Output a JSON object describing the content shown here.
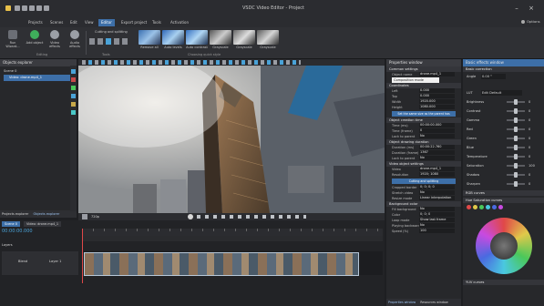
{
  "app": {
    "title": "VSDC Video Editor - Project"
  },
  "menu": {
    "items": [
      "Projects",
      "Scenes",
      "Edit",
      "View",
      "Editor",
      "Export project",
      "Tools",
      "Activation"
    ],
    "active": 4,
    "options_label": "Options"
  },
  "ribbon": {
    "run_wizard": "Run Wizard...",
    "add_object": "Add object",
    "video_effects": "Video effects",
    "audio_effects": "Audio effects",
    "editing_group": "Editing",
    "tools_group": "Tools",
    "cutting_label": "Cutting and splitting",
    "quick_style_group": "Choosing quick style",
    "quick_styles": [
      "Remove all",
      "Auto levels",
      "Auto contrast",
      "Grayscale",
      "Grayscale",
      "Grayscale"
    ]
  },
  "objects_explorer": {
    "title": "Objects explorer",
    "items": [
      "Scene 0",
      "Video: drone.mp4_1"
    ],
    "tabs": [
      "Projects explorer",
      "Objects explorer"
    ]
  },
  "timeline": {
    "timecode": "00:00:00.000",
    "scene_tab": "Scene 0",
    "clip_tab": "Video: drone.mp4_1",
    "layers_label": "Layers",
    "blend_label": "Blend",
    "layer_label": "Layer 1",
    "zoom": "720p"
  },
  "properties": {
    "title": "Properties window",
    "common_settings": "Common settings",
    "object_name_label": "Object name",
    "object_name_value": "drone.mp4_1",
    "composition_mode_tooltip": "Composition mode",
    "coordinates": "Coordinates",
    "coords": [
      {
        "k": "Left",
        "v": "0.000"
      },
      {
        "k": "Top",
        "v": "0.000"
      },
      {
        "k": "Width",
        "v": "1920.000"
      },
      {
        "k": "Height",
        "v": "1080.000"
      }
    ],
    "same_size_btn": "Set the same size as the parent has",
    "creation_time": "Object creation time",
    "creation": [
      {
        "k": "Time (ms)",
        "v": "00:00:00.000"
      },
      {
        "k": "Time (frame)",
        "v": "0"
      },
      {
        "k": "Lock to parent",
        "v": "No"
      }
    ],
    "drawing_duration": "Object drawing duration",
    "duration": [
      {
        "k": "Duration (ms)",
        "v": "00:00:22.760"
      },
      {
        "k": "Duration (frame)",
        "v": "1367"
      },
      {
        "k": "Lock to parent",
        "v": "No"
      }
    ],
    "video_settings": "Video object settings",
    "video": [
      {
        "k": "Video",
        "v": "drone.mp4_1"
      },
      {
        "k": "Resolution",
        "v": "1920; 1080"
      }
    ],
    "cutting_btn": "Cutting and splitting",
    "video2": [
      {
        "k": "Cropped border",
        "v": "0; 0; 0; 0"
      },
      {
        "k": "Stretch video",
        "v": "No"
      },
      {
        "k": "Resize mode",
        "v": "Linear interpolation"
      }
    ],
    "background_color": "Background color",
    "bg": [
      {
        "k": "Fill background",
        "v": "No"
      },
      {
        "k": "Color",
        "v": "0; 0; 0"
      },
      {
        "k": "Loop mode",
        "v": "Show last frame"
      },
      {
        "k": "Playing backward",
        "v": "No"
      },
      {
        "k": "Speed (%)",
        "v": "100"
      }
    ],
    "bottom_tabs": [
      "Properties window",
      "Resources window"
    ]
  },
  "effects": {
    "title": "Basic effects window",
    "basic_correction": "Basic correction",
    "angle_label": "Angle",
    "angle_value": "0.00 °",
    "lut_label": "LUT",
    "lut_value": "Edit Default",
    "rows": [
      {
        "k": "Brightness",
        "v": "0",
        "level": 0.5
      },
      {
        "k": "Contrast",
        "v": "0",
        "level": 0.5
      },
      {
        "k": "Gamma",
        "v": "0",
        "level": 0.5
      },
      {
        "k": "Red",
        "v": "0",
        "level": 0.5
      },
      {
        "k": "Green",
        "v": "0",
        "level": 0.5
      },
      {
        "k": "Blue",
        "v": "0",
        "level": 0.5
      },
      {
        "k": "Temperature",
        "v": "0",
        "level": 0.5
      },
      {
        "k": "Saturation",
        "v": "100",
        "level": 0.5
      },
      {
        "k": "Shadow",
        "v": "0",
        "level": 0.5
      },
      {
        "k": "Sharpen",
        "v": "0",
        "level": 0.5
      }
    ],
    "rgb_curves": "RGB curves",
    "hue_sat": "Hue Saturation curves",
    "yuv": "YUV curves",
    "swatch_colors": [
      "#e04848",
      "#e0c84a",
      "#4ac85a",
      "#4ac8e0",
      "#4a6ae0",
      "#c84ae0"
    ]
  },
  "colors": {
    "accent": "#3d6fa8",
    "panel": "#27282b",
    "header": "#3a3b40"
  }
}
